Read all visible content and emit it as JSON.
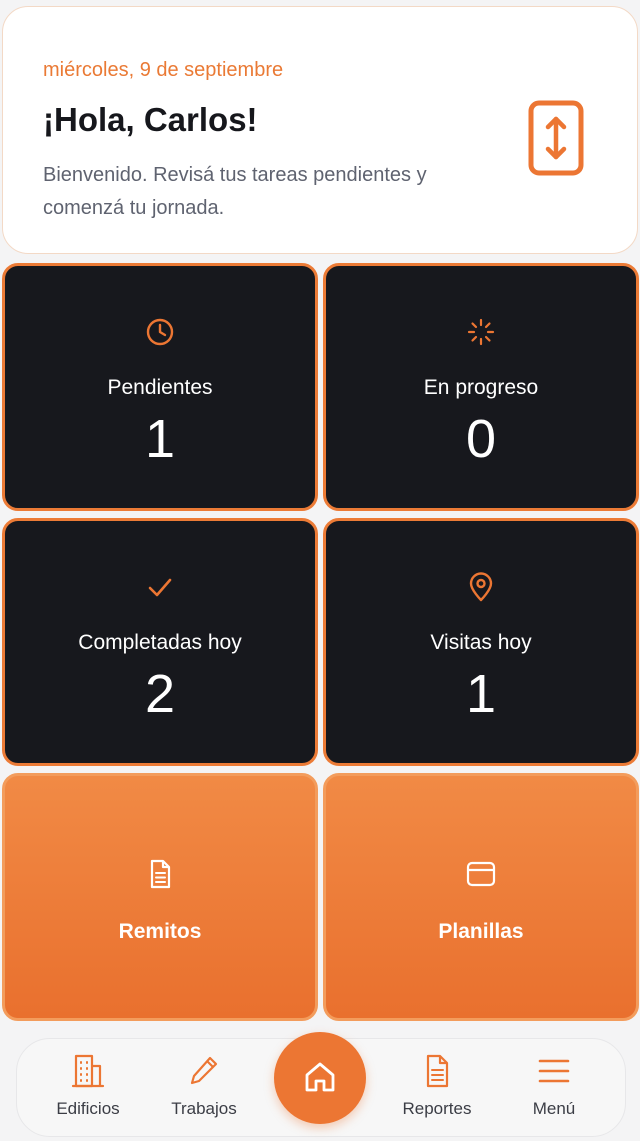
{
  "header": {
    "date": "miércoles, 9 de septiembre",
    "greeting": "¡Hola, Carlos!",
    "intro": "Bienvenido. Revisá tus tareas pendientes y comenzá tu jornada.",
    "icon": "elevator-icon"
  },
  "stats": [
    {
      "label": "Pendientes",
      "value": "1",
      "icon": "clock-icon"
    },
    {
      "label": "En progreso",
      "value": "0",
      "icon": "loader-icon"
    },
    {
      "label": "Completadas hoy",
      "value": "2",
      "icon": "check-icon"
    },
    {
      "label": "Visitas hoy",
      "value": "1",
      "icon": "map-pin-icon"
    }
  ],
  "actions": [
    {
      "label": "Remitos",
      "icon": "document-icon"
    },
    {
      "label": "Planillas",
      "icon": "window-icon"
    }
  ],
  "nav": {
    "items": [
      {
        "label": "Edificios",
        "icon": "building-icon"
      },
      {
        "label": "Trabajos",
        "icon": "pencil-icon"
      },
      {
        "label": "Reportes",
        "icon": "document-icon"
      },
      {
        "label": "Menú",
        "icon": "menu-icon"
      }
    ],
    "home_icon": "home-icon"
  },
  "colors": {
    "accent": "#ec7633",
    "dark_tile": "#17181d",
    "background": "#f4f4f5"
  }
}
